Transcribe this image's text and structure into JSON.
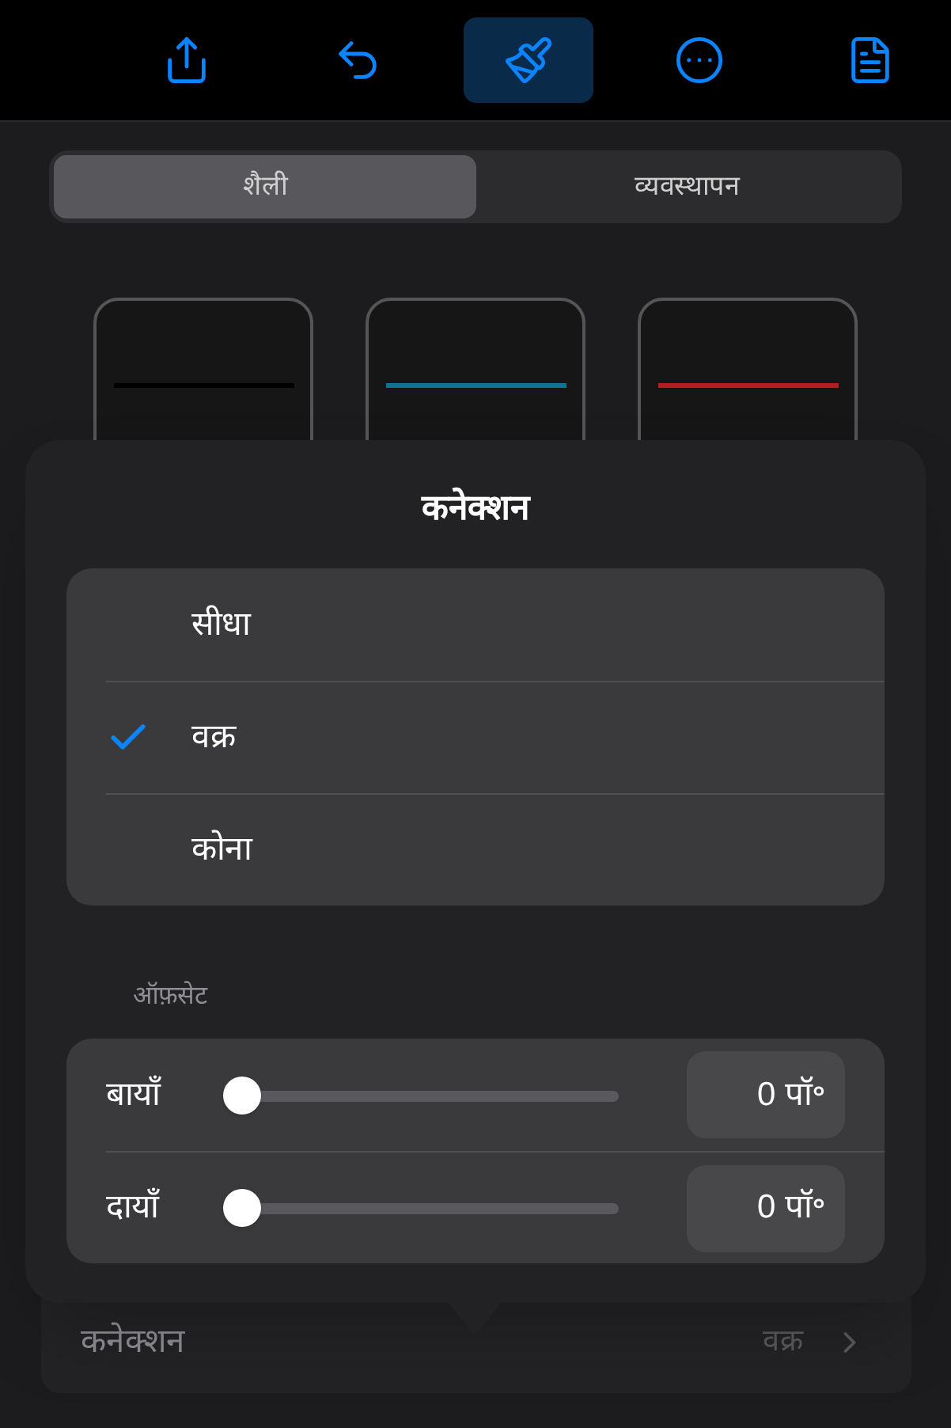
{
  "toolbar": [
    {
      "kind": "share",
      "selected": false
    },
    {
      "kind": "undo",
      "selected": false
    },
    {
      "kind": "brush",
      "selected": true
    },
    {
      "kind": "more",
      "selected": false
    },
    {
      "kind": "reader",
      "selected": false
    }
  ],
  "tabs": [
    {
      "label": "शैली",
      "selected": true
    },
    {
      "label": "व्यवस्थापन",
      "selected": false
    }
  ],
  "styles": [
    {
      "color": "#000000"
    },
    {
      "color": "#0e7490"
    },
    {
      "color": "#b91c1c"
    }
  ],
  "popover": {
    "title": "कनेक्शन",
    "options": [
      {
        "label": "सीधा",
        "selected": false
      },
      {
        "label": "वक्र",
        "selected": true
      },
      {
        "label": "कोना",
        "selected": false
      }
    ],
    "offset_label": "ऑफ़सेट",
    "sliders": [
      {
        "label": "बायाँ",
        "level": 0,
        "value": "0 पॉ॰"
      },
      {
        "label": "दायाँ",
        "level": 0,
        "value": "0 पॉ॰"
      }
    ]
  },
  "connection_row": {
    "label": "कनेक्शन",
    "value": "वक्र"
  }
}
